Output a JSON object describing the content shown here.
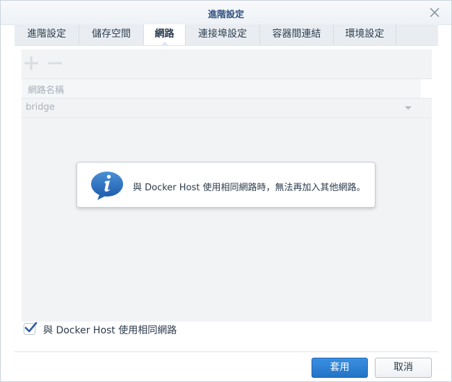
{
  "dialog": {
    "title": "進階設定"
  },
  "tabs": [
    {
      "label": "進階設定",
      "active": false
    },
    {
      "label": "儲存空間",
      "active": false
    },
    {
      "label": "網路",
      "active": true
    },
    {
      "label": "連接埠設定",
      "active": false
    },
    {
      "label": "容器間連結",
      "active": false
    },
    {
      "label": "環境設定",
      "active": false
    }
  ],
  "toolbar": {
    "add_icon": "plus-icon",
    "remove_icon": "minus-icon"
  },
  "table": {
    "header": "網路名稱",
    "rows": [
      {
        "network": "bridge"
      }
    ]
  },
  "info": {
    "icon": "info-speech-bubble-icon",
    "message": "與 Docker Host 使用相同網路時，無法再加入其他網路。"
  },
  "option": {
    "checked": true,
    "label": "與 Docker Host 使用相同網路"
  },
  "buttons": {
    "apply": "套用",
    "cancel": "取消"
  },
  "colors": {
    "accent": "#2b7bd3",
    "title": "#2f4f7f"
  }
}
